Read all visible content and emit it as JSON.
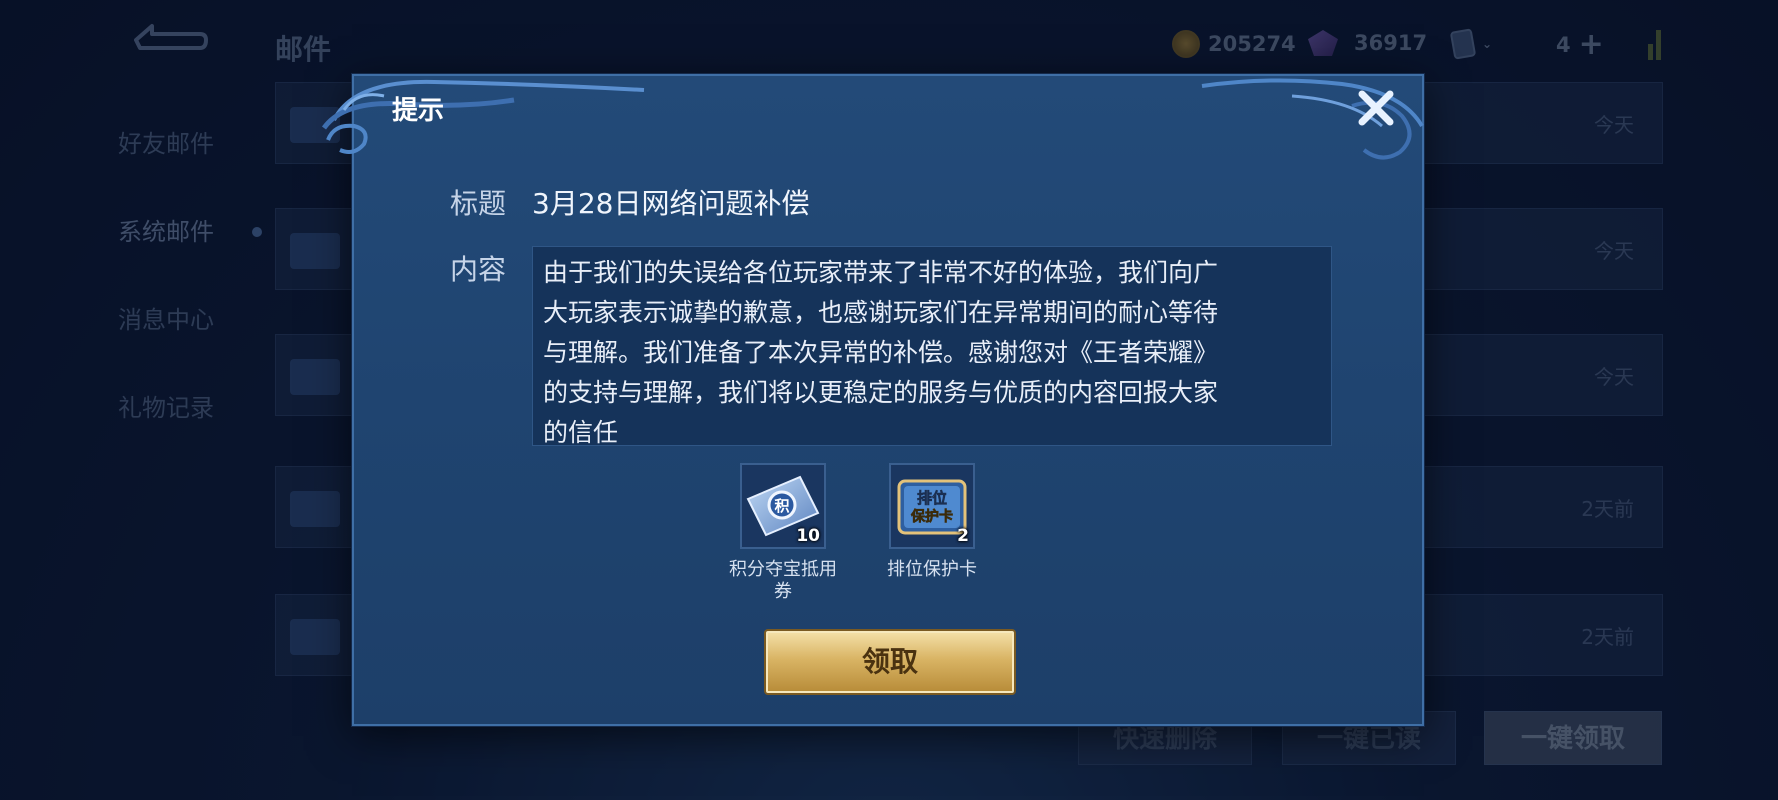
{
  "header": {
    "title": "邮件",
    "gold": "205274",
    "gems": "36917",
    "tickets": "4"
  },
  "sidebar": {
    "items": [
      {
        "label": "好友邮件"
      },
      {
        "label": "系统邮件"
      },
      {
        "label": "消息中心"
      },
      {
        "label": "礼物记录"
      }
    ]
  },
  "mail_list": [
    {
      "time": "今天"
    },
    {
      "time": "今天"
    },
    {
      "time": "今天"
    },
    {
      "time": "2天前"
    },
    {
      "time": "2天前"
    }
  ],
  "bottom_actions": {
    "quick_delete": "快速删除",
    "mark_all_read": "一键已读",
    "claim_all": "一键领取"
  },
  "dialog": {
    "title": "提示",
    "subject_label": "标题",
    "subject": "3月28日网络问题补偿",
    "content_label": "内容",
    "content": "由于我们的失误给各位玩家带来了非常不好的体验，我们向广\n大玩家表示诚挚的歉意，也感谢玩家们在异常期间的耐心等待\n与理解。我们准备了本次异常的补偿。感谢您对《王者荣耀》\n的支持与理解，我们将以更稳定的服务与优质的内容回报大家\n的信任",
    "rewards": [
      {
        "name": "积分夺宝抵用券",
        "count": "10",
        "icon": "points-voucher-icon",
        "icon_text": "积"
      },
      {
        "name": "排位保护卡",
        "count": "2",
        "icon": "rank-protect-card-icon",
        "icon_text_1": "排位",
        "icon_text_2": "保护卡"
      }
    ],
    "claim_button": "领取"
  }
}
